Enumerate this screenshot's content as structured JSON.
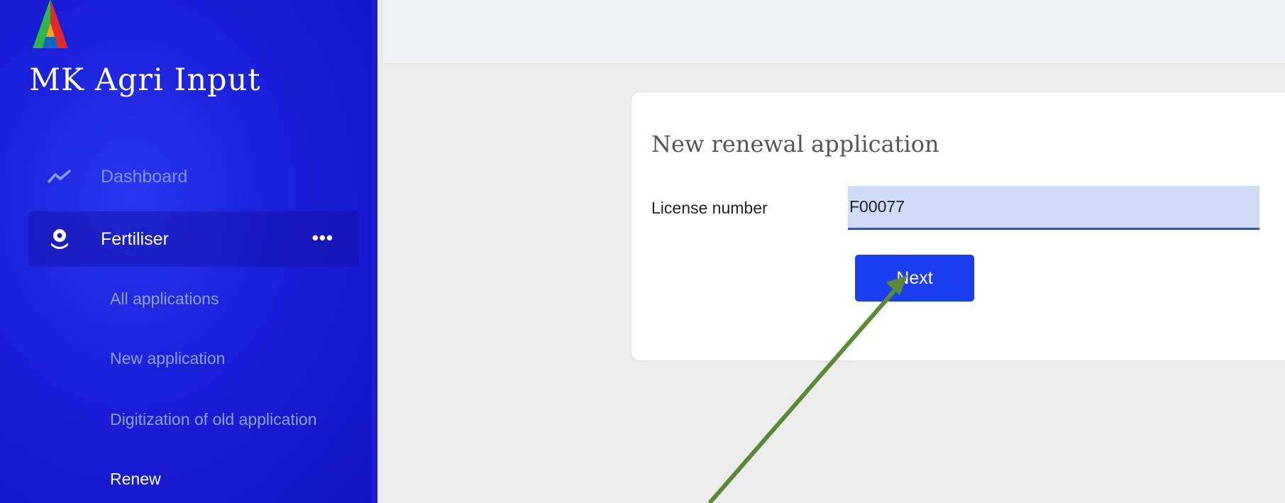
{
  "app": {
    "brand": "MK Agri Input"
  },
  "sidebar": {
    "items": [
      {
        "label": "Dashboard",
        "icon": "trend-line-icon"
      },
      {
        "label": "Fertiliser",
        "icon": "flower-icon",
        "more": "•••"
      }
    ],
    "subitems": [
      {
        "label": "All applications"
      },
      {
        "label": "New application"
      },
      {
        "label": "Digitization of old application"
      },
      {
        "label": "Renew"
      }
    ]
  },
  "form": {
    "title": "New renewal application",
    "license_label": "License number",
    "license_value": "F00077",
    "next_label": "Next"
  },
  "colors": {
    "sidebar": "#1a1fd8",
    "accent": "#1b3ef0",
    "annotation_arrow": "#5a8a34"
  }
}
